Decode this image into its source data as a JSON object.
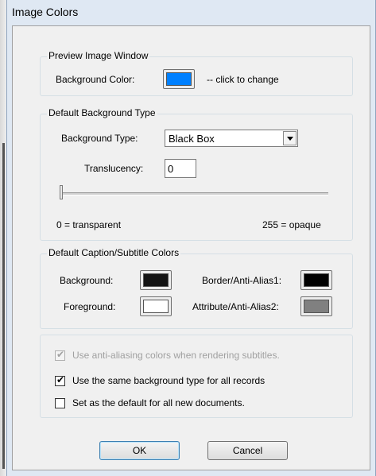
{
  "window": {
    "title": "Image Colors"
  },
  "preview": {
    "legend": "Preview Image Window",
    "bg_label": "Background Color:",
    "bg_color": "#0080ff",
    "hint": "-- click to change"
  },
  "default_bg": {
    "legend": "Default Background Type",
    "type_label": "Background Type:",
    "type_value": "Black Box",
    "translucency_label": "Translucency:",
    "translucency_value": "0",
    "slider_min_label": "0 = transparent",
    "slider_max_label": "255 = opaque",
    "slider_value": 0
  },
  "caption_colors": {
    "legend": "Default Caption/Subtitle Colors",
    "background_label": "Background:",
    "background_color": "#141414",
    "foreground_label": "Foreground:",
    "foreground_color": "#ffffff",
    "border_label": "Border/Anti-Alias1:",
    "border_color": "#000000",
    "attribute_label": "Attribute/Anti-Alias2:",
    "attribute_color": "#808080"
  },
  "options": {
    "antialias_label": "Use anti-aliasing colors when rendering subtitles.",
    "antialias_checked": true,
    "antialias_enabled": false,
    "same_bg_label": "Use the same background type for all records",
    "same_bg_checked": true,
    "default_label": "Set as the default for all new documents.",
    "default_checked": false
  },
  "buttons": {
    "ok": "OK",
    "cancel": "Cancel"
  }
}
